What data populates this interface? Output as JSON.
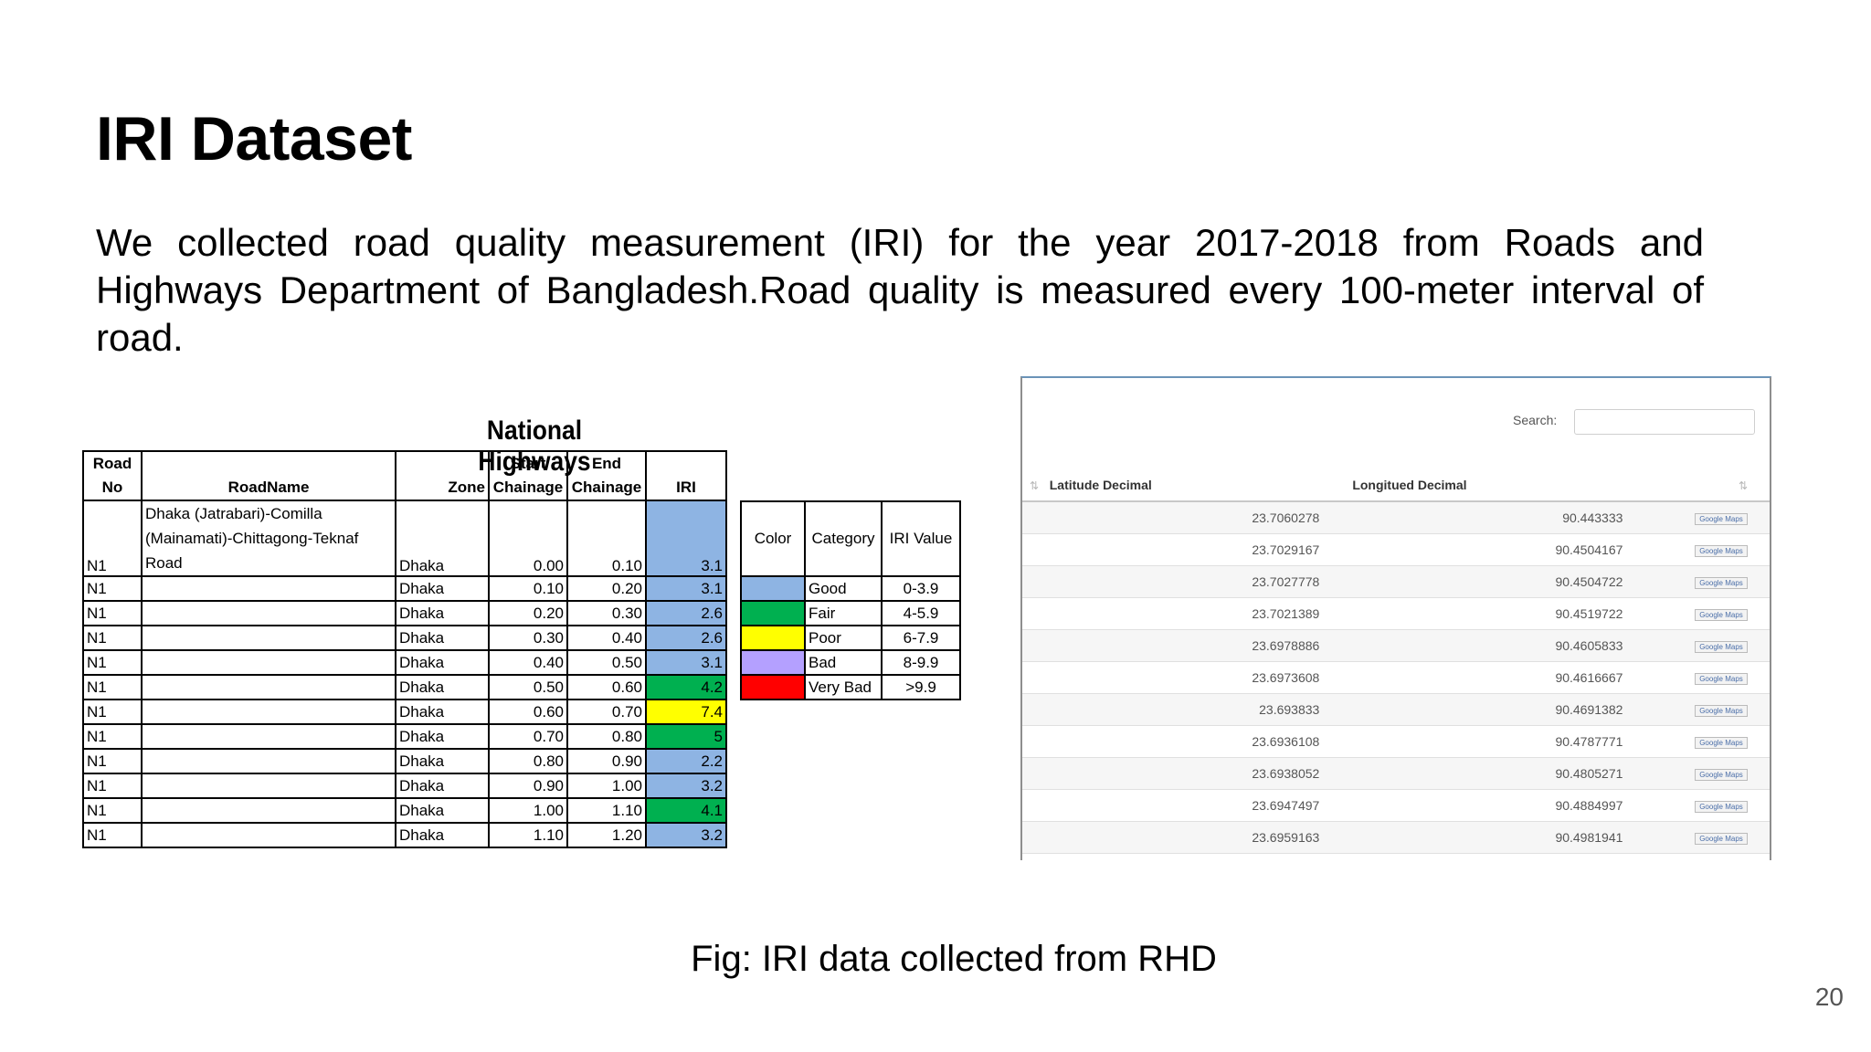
{
  "slide": {
    "title": "IRI Dataset",
    "body": "We collected road quality measurement (IRI) for the year 2017-2018 from Roads and Highways Department of Bangladesh.Road quality is measured every 100-meter interval of road.",
    "caption": "Fig: IRI data collected from RHD",
    "page_number": "20"
  },
  "highways_table": {
    "title": "National Highways",
    "headers": {
      "road_no": [
        "Road",
        "No"
      ],
      "road_name": "RoadName",
      "zone": "Zone",
      "start": [
        "Start",
        "Chainage"
      ],
      "end": [
        "End",
        "Chainage"
      ],
      "iri": "IRI"
    },
    "rows": [
      {
        "road": "N1",
        "name": "Dhaka (Jatrabari)-Comilla (Mainamati)-Chittagong-Teknaf Road",
        "zone": "Dhaka",
        "start": "0.00",
        "end": "0.10",
        "iri": "3.1",
        "color": "#8eb4e3"
      },
      {
        "road": "N1",
        "name": "",
        "zone": "Dhaka",
        "start": "0.10",
        "end": "0.20",
        "iri": "3.1",
        "color": "#8eb4e3"
      },
      {
        "road": "N1",
        "name": "",
        "zone": "Dhaka",
        "start": "0.20",
        "end": "0.30",
        "iri": "2.6",
        "color": "#8eb4e3"
      },
      {
        "road": "N1",
        "name": "",
        "zone": "Dhaka",
        "start": "0.30",
        "end": "0.40",
        "iri": "2.6",
        "color": "#8eb4e3"
      },
      {
        "road": "N1",
        "name": "",
        "zone": "Dhaka",
        "start": "0.40",
        "end": "0.50",
        "iri": "3.1",
        "color": "#8eb4e3"
      },
      {
        "road": "N1",
        "name": "",
        "zone": "Dhaka",
        "start": "0.50",
        "end": "0.60",
        "iri": "4.2",
        "color": "#00b050"
      },
      {
        "road": "N1",
        "name": "",
        "zone": "Dhaka",
        "start": "0.60",
        "end": "0.70",
        "iri": "7.4",
        "color": "#ffff00"
      },
      {
        "road": "N1",
        "name": "",
        "zone": "Dhaka",
        "start": "0.70",
        "end": "0.80",
        "iri": "5",
        "color": "#00b050"
      },
      {
        "road": "N1",
        "name": "",
        "zone": "Dhaka",
        "start": "0.80",
        "end": "0.90",
        "iri": "2.2",
        "color": "#8eb4e3"
      },
      {
        "road": "N1",
        "name": "",
        "zone": "Dhaka",
        "start": "0.90",
        "end": "1.00",
        "iri": "3.2",
        "color": "#8eb4e3"
      },
      {
        "road": "N1",
        "name": "",
        "zone": "Dhaka",
        "start": "1.00",
        "end": "1.10",
        "iri": "4.1",
        "color": "#00b050"
      },
      {
        "road": "N1",
        "name": "",
        "zone": "Dhaka",
        "start": "1.10",
        "end": "1.20",
        "iri": "3.2",
        "color": "#8eb4e3"
      }
    ]
  },
  "legend_table": {
    "headers": {
      "color": "Color",
      "category": "Category",
      "value": "IRI Value"
    },
    "rows": [
      {
        "color": "#8eb4e3",
        "category": "Good",
        "value": "0-3.9"
      },
      {
        "color": "#00b050",
        "category": "Fair",
        "value": "4-5.9"
      },
      {
        "color": "#ffff00",
        "category": "Poor",
        "value": "6-7.9"
      },
      {
        "color": "#b4a0ff",
        "category": "Bad",
        "value": "8-9.9"
      },
      {
        "color": "#ff0000",
        "category": "Very Bad",
        "value": ">9.9"
      }
    ]
  },
  "geo_table": {
    "search_label": "Search:",
    "search_value": "",
    "headers": {
      "lat": "Latitude Decimal",
      "lon": "Longitued Decimal"
    },
    "link_icon": "google-maps-icon",
    "link_text": "Google Maps",
    "rows": [
      {
        "lat": "23.7060278",
        "lon": "90.443333"
      },
      {
        "lat": "23.7029167",
        "lon": "90.4504167"
      },
      {
        "lat": "23.7027778",
        "lon": "90.4504722"
      },
      {
        "lat": "23.7021389",
        "lon": "90.4519722"
      },
      {
        "lat": "23.6978886",
        "lon": "90.4605833"
      },
      {
        "lat": "23.6973608",
        "lon": "90.4616667"
      },
      {
        "lat": "23.693833",
        "lon": "90.4691382"
      },
      {
        "lat": "23.6936108",
        "lon": "90.4787771"
      },
      {
        "lat": "23.6938052",
        "lon": "90.4805271"
      },
      {
        "lat": "23.6947497",
        "lon": "90.4884997"
      },
      {
        "lat": "23.6959163",
        "lon": "90.4981941"
      }
    ]
  }
}
